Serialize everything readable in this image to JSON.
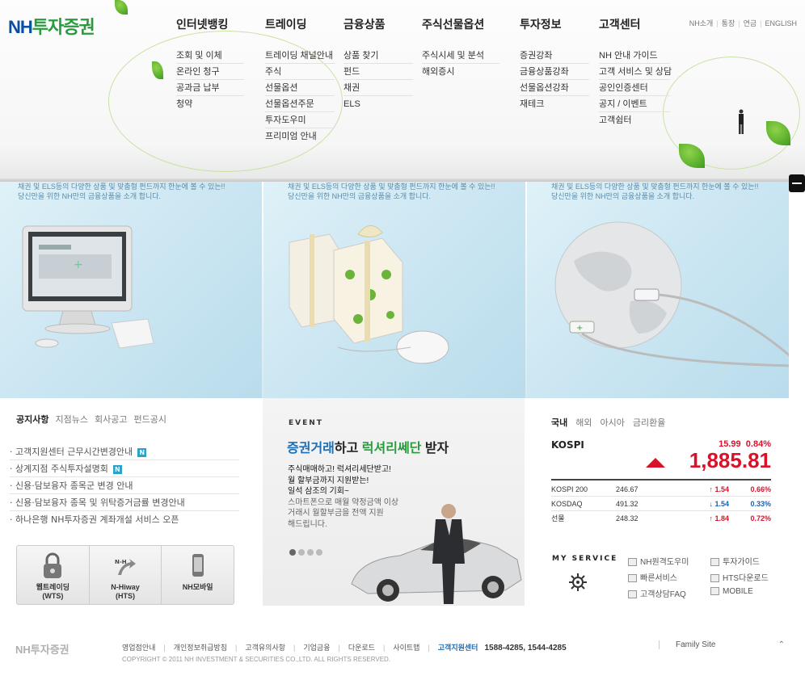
{
  "logo": {
    "nh": "NH",
    "rest": "투자증권"
  },
  "topmenu": [
    "NH소개",
    "통장",
    "연금",
    "ENGLISH"
  ],
  "gnb": [
    {
      "title": "인터넷뱅킹",
      "items": [
        "조회 및 이체",
        "온라인 청구",
        "공과금 납부",
        "청약"
      ]
    },
    {
      "title": "트레이딩",
      "items": [
        "트레이딩 채널안내",
        "주식",
        "선물옵션",
        "선물옵션주문",
        "투자도우미",
        "프리미엄 안내"
      ]
    },
    {
      "title": "금융상품",
      "items": [
        "상품 찾기",
        "펀드",
        "채권",
        "ELS"
      ]
    },
    {
      "title": "주식선물옵션",
      "items": [
        "주식시세 및 분석",
        "해외증시"
      ]
    },
    {
      "title": "투자정보",
      "items": [
        "증권강좌",
        "금융상품강좌",
        "선물옵션강좌",
        "재테크"
      ]
    },
    {
      "title": "고객센터",
      "items": [
        "NH 안내 가이드",
        "고객 서비스 및 상담",
        "공인인증센터",
        "공지 / 이벤트",
        "고객쉼터"
      ]
    }
  ],
  "banners": [
    {
      "text": "채권 및 ELS등의 다양한 상품 및 맞춤형 펀드까지 한눈에 볼 수 있는!! 당신만을 위한 NH만의 금융상품을 소개 합니다."
    },
    {
      "text": "채권 및 ELS등의 다양한 상품 및 맞춤형 펀드까지 한눈에 볼 수 있는!! 당신만을 위한 NH만의 금융상품을 소개 합니다."
    },
    {
      "text": "채권 및 ELS등의 다양한 상품 및 맞춤형 펀드까지 한눈에 볼 수 있는!! 당신만을 위한 NH만의 금융상품을 소개 합니다."
    }
  ],
  "notice": {
    "tabs": [
      "공지사항",
      "지점뉴스",
      "회사공고",
      "펀드공시"
    ],
    "items": [
      {
        "text": "· 고객지원센터 근무시간변경안내",
        "badge": "N"
      },
      {
        "text": "· 상계지점 주식투자설명회",
        "badge": "N"
      },
      {
        "text": "· 신용·담보융자 종목군 변경 안내",
        "badge": ""
      },
      {
        "text": "· 신용·담보융자 종목 및 위탁증거금률 변경안내",
        "badge": ""
      },
      {
        "text": "· 하나은행 NH투자증권 계좌개설 서비스 오픈",
        "badge": ""
      }
    ],
    "quick": [
      {
        "line1": "웹트레이딩",
        "line2": "(WTS)",
        "icon": "lock-icon"
      },
      {
        "line1": "N-Hiway",
        "line2": "(HTS)",
        "icon": "arrow-icon"
      },
      {
        "line1": "NH모바일",
        "line2": "",
        "icon": "phone-icon"
      }
    ]
  },
  "event": {
    "label": "EVENT",
    "title_a": "증권거래",
    "title_b": "하고 ",
    "title_c": "럭셔리쎄단",
    "title_d": " 받자",
    "desc": [
      "주식매매하고! 럭셔리세단받고!",
      "월 할부금까지 지원받는!",
      "일석 삼조의 기회~"
    ],
    "desc_dim": [
      "스마트폰으로 매월 약정금액 이상",
      "거래시 월할부금을 전액 지원",
      "해드립니다."
    ]
  },
  "stock": {
    "tabs": [
      "국내",
      "해외",
      "아시아",
      "금리환율"
    ],
    "kospi": {
      "label": "KOSPI",
      "change": "15.99",
      "percent": "0.84%",
      "value": "1,885.81"
    },
    "rows": [
      {
        "name": "KOSPI 200",
        "value": "246.67",
        "change": "↑ 1.54",
        "percent": "0.66%",
        "dir": "up"
      },
      {
        "name": "KOSDAQ",
        "value": "491.32",
        "change": "↓ 1.54",
        "percent": "0.33%",
        "dir": "down"
      },
      {
        "name": "선물",
        "value": "248.32",
        "change": "↑ 1.84",
        "percent": "0.72%",
        "dir": "up"
      }
    ],
    "myservice": "MY SERVICE",
    "services": [
      "NH원격도우미",
      "투자가이드",
      "빠른서비스",
      "HTS다운로드",
      "고객상담FAQ",
      "MOBILE"
    ]
  },
  "footer": {
    "logo": "NH투자증권",
    "links": [
      "영업점안내",
      "개인정보취급방침",
      "고객유의사항",
      "기업금융",
      "다운로드",
      "사이트맵"
    ],
    "highlight": "고객지원센터",
    "phone": "1588-4285, 1544-4285",
    "copyright": "COPYRIGHT © 2011 NH INVESTMENT & SECURITIES CO.,LTD. ALL RIGHTS RESERVED.",
    "family": "Family Site"
  }
}
